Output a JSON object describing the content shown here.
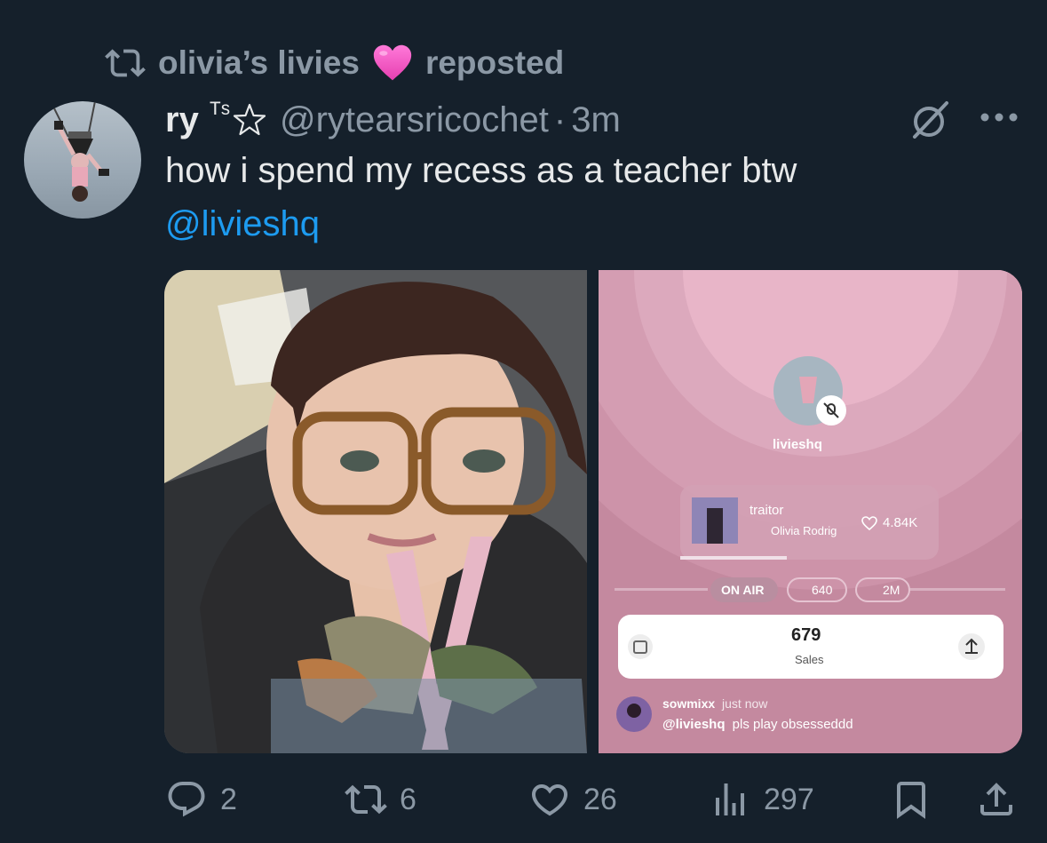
{
  "repost": {
    "reposter": "olivia’s livies",
    "label": "reposted"
  },
  "post": {
    "display_name": "ry",
    "name_suffix": "ᵀˢ",
    "handle": "@rytearsricochet",
    "separator": "·",
    "time": "3m",
    "text": "how i spend my recess as a teacher btw",
    "mention": "@livieshq"
  },
  "embedded_screenshot": {
    "host": "livieshq",
    "song_title": "traitor",
    "song_artist": "Olivia Rodrig",
    "likes": "4.84K",
    "on_air": "ON AIR",
    "listeners": "640",
    "plays": "2M",
    "sales_count": "679",
    "sales_label": "Sales",
    "comment_user": "sowmixx",
    "comment_time": "just now",
    "comment_mention": "@livieshq",
    "comment_text": "pls play obsesseddd"
  },
  "actions": {
    "replies": "2",
    "reposts": "6",
    "likes": "26",
    "views": "297"
  },
  "colors": {
    "background": "#15202b",
    "muted": "#8b98a5",
    "link": "#1d9bf0",
    "text": "#e7e9ea"
  }
}
